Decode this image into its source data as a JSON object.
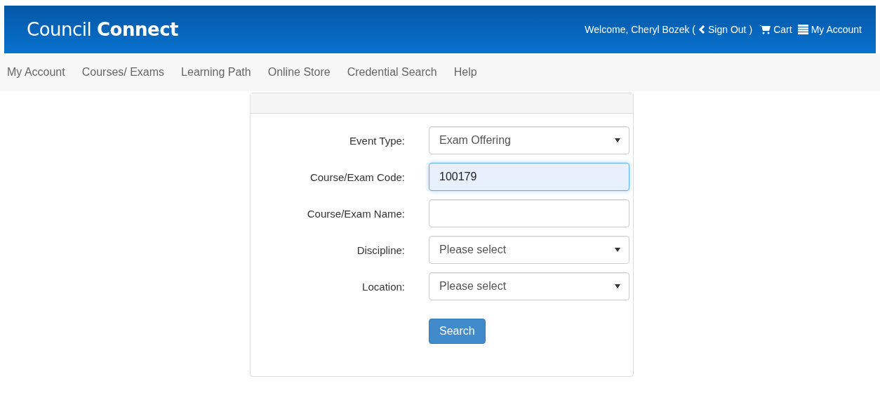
{
  "header": {
    "logo": "Council **Connect**",
    "welcome": "Welcome, Cheryl Bozek (",
    "sign_out": "Sign Out",
    "close_paren": ")",
    "cart": "Cart",
    "account": "My Account"
  },
  "nav": [
    {
      "label": "My Account"
    },
    {
      "label": "Courses/ Exams"
    },
    {
      "label": "Learning Path"
    },
    {
      "label": "Online Store"
    },
    {
      "label": "Credential Search"
    },
    {
      "label": "Help"
    }
  ],
  "form": {
    "fields": [
      {
        "label": "Event Type:",
        "kind": "select",
        "value": "Exam Offering",
        "focused": false
      },
      {
        "label": "Course/Exam Code:",
        "kind": "text",
        "value": "100179",
        "focused": true
      },
      {
        "label": "Course/Exam Name:",
        "kind": "text",
        "focused": false
      },
      {
        "label": "Discipline:",
        "kind": "select",
        "value": "Please select",
        "focused": false
      },
      {
        "label": "Location:",
        "kind": "select",
        "value": "Please select",
        "focused": false
      }
    ],
    "button": "Search"
  }
}
